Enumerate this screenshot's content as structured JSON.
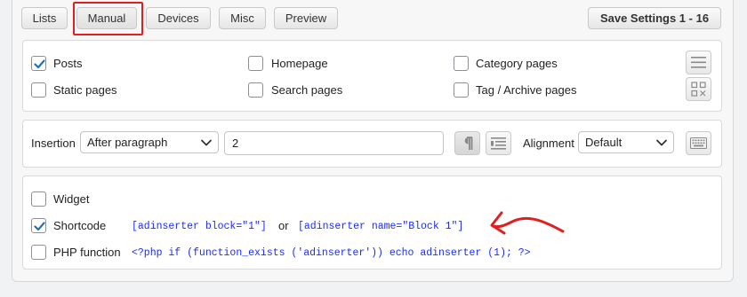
{
  "tabs": [
    {
      "label": "Lists"
    },
    {
      "label": "Manual"
    },
    {
      "label": "Devices"
    },
    {
      "label": "Misc"
    },
    {
      "label": "Preview"
    }
  ],
  "save_button": "Save Settings 1 - 16",
  "page_types": {
    "posts": {
      "label": "Posts",
      "checked": true
    },
    "homepage": {
      "label": "Homepage",
      "checked": false
    },
    "category_pages": {
      "label": "Category pages",
      "checked": false
    },
    "static_pages": {
      "label": "Static pages",
      "checked": false
    },
    "search_pages": {
      "label": "Search pages",
      "checked": false
    },
    "tag_archive_pages": {
      "label": "Tag / Archive pages",
      "checked": false
    }
  },
  "insertion": {
    "label": "Insertion",
    "selected": "After paragraph",
    "paragraph_value": "2",
    "alignment_label": "Alignment",
    "alignment_selected": "Default"
  },
  "manual": {
    "widget": {
      "label": "Widget",
      "checked": false
    },
    "shortcode": {
      "label": "Shortcode",
      "checked": true,
      "code1": "[adinserter block=\"1\"]",
      "or": "or",
      "code2": "[adinserter name=\"Block 1\"]"
    },
    "php": {
      "label": "PHP function",
      "checked": false,
      "code": "<?php if (function_exists ('adinserter')) echo adinserter (1); ?>"
    }
  },
  "colors": {
    "highlight": "#e02020",
    "code": "#1a2cff",
    "checkbox": "#2271b1"
  }
}
